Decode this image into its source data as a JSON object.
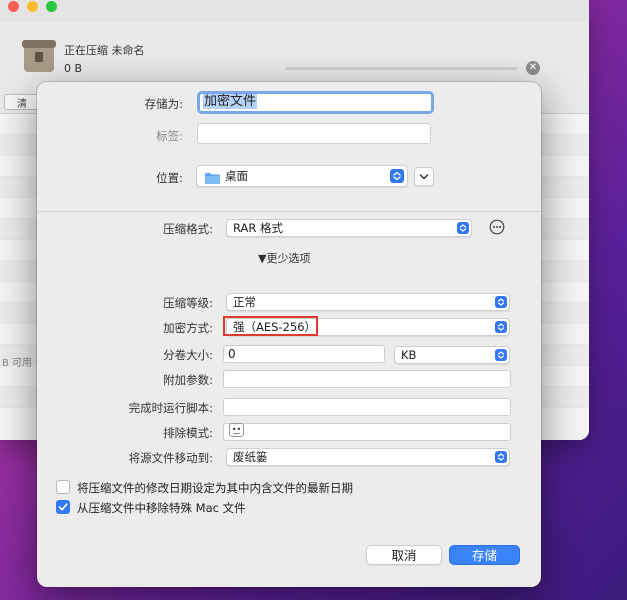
{
  "background": {
    "progress_title": "正在压缩 未命名",
    "progress_size": "0 B",
    "left_button": "清",
    "status_text": "B 可用"
  },
  "dialog": {
    "save_as_label": "存储为:",
    "save_as_value": "加密文件",
    "tags_label": "标签:",
    "tags_value": "",
    "location_label": "位置:",
    "location_value": "桌面",
    "format_label": "压缩格式:",
    "format_value": "RAR 格式",
    "disclosure_label": "▼更少选项",
    "level_label": "压缩等级:",
    "level_value": "正常",
    "encryption_label": "加密方式:",
    "encryption_value": "强（AES-256）",
    "split_label": "分卷大小:",
    "split_value": "0",
    "split_unit": "KB",
    "extra_params_label": "附加参数:",
    "extra_params_value": "",
    "run_script_label": "完成时运行脚本:",
    "run_script_value": "",
    "exclude_label": "排除模式:",
    "move_source_label": "将源文件移动到:",
    "move_source_value": "废纸篓",
    "checkbox_date_label": "将压缩文件的修改日期设定为其中内含文件的最新日期",
    "checkbox_date_checked": false,
    "checkbox_mac_label": "从压缩文件中移除特殊 Mac 文件",
    "checkbox_mac_checked": true,
    "cancel_label": "取消",
    "save_label": "存储"
  },
  "colors": {
    "accent": "#3478f6",
    "highlight_box": "#e03a2e"
  }
}
